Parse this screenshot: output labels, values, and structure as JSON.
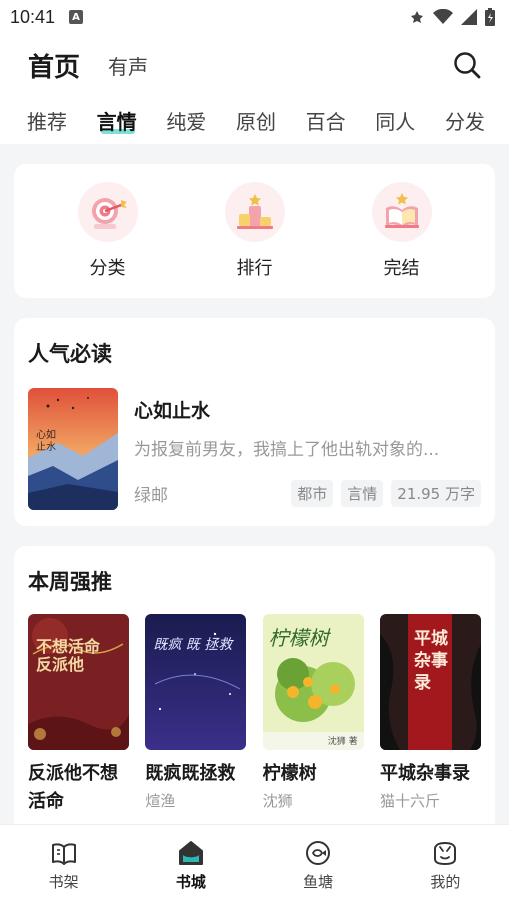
{
  "status": {
    "time": "10:41"
  },
  "header": {
    "title": "首页",
    "subtitle": "有声"
  },
  "tabs": [
    "推荐",
    "言情",
    "纯爱",
    "原创",
    "百合",
    "同人",
    "分发"
  ],
  "active_tab": "言情",
  "categories": [
    {
      "label": "分类",
      "icon": "target-icon"
    },
    {
      "label": "排行",
      "icon": "podium-icon"
    },
    {
      "label": "完结",
      "icon": "book-star-icon"
    }
  ],
  "popular": {
    "title": "人气必读",
    "book": {
      "title": "心如止水",
      "description": "为报复前男友，我搞上了他出轨对象的...",
      "author": "绿邮",
      "tags": [
        "都市",
        "言情",
        "21.95 万字"
      ],
      "cover_text": "心如止水"
    }
  },
  "weekly": {
    "title": "本周强推",
    "books": [
      {
        "title": "反派他不想活命",
        "author": "",
        "cover_text": "不想活命 反派他"
      },
      {
        "title": "既疯既拯救",
        "author": "煊渔",
        "cover_text": "既疯 既 拯救"
      },
      {
        "title": "柠檬树",
        "author": "沈狮",
        "cover_text": "柠檬树",
        "cover_sub": "沈狮 著"
      },
      {
        "title": "平城杂事录",
        "author": "猫十六斤",
        "cover_text": "平城杂事录"
      }
    ]
  },
  "nav": [
    {
      "label": "书架",
      "icon": "bookshelf-icon"
    },
    {
      "label": "书城",
      "icon": "bookstore-icon"
    },
    {
      "label": "鱼塘",
      "icon": "fishpond-icon"
    },
    {
      "label": "我的",
      "icon": "profile-icon"
    }
  ],
  "colors": {
    "accent": "#2bb8ae",
    "tab_underline": "#7fe0d8",
    "category_bg": "#fdeff0"
  }
}
